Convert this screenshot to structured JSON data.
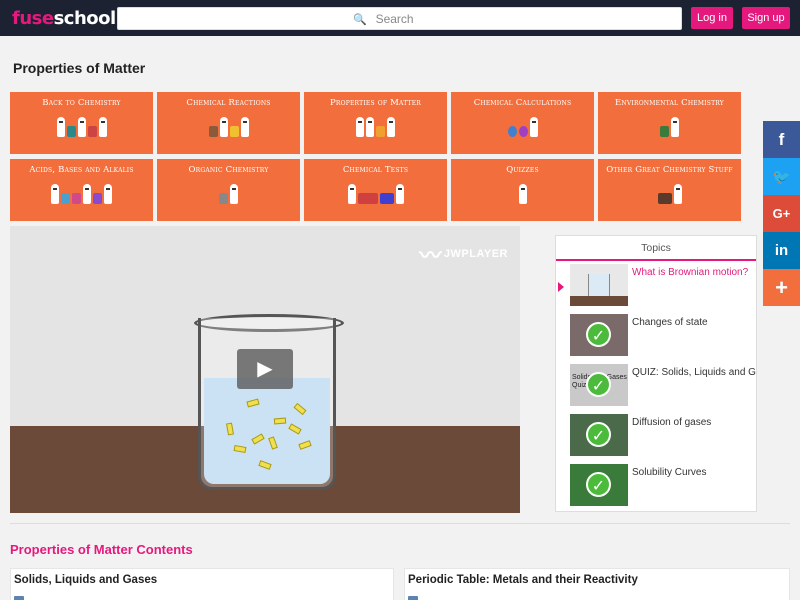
{
  "header": {
    "logo_prefix": "fuse",
    "logo_suffix": "school",
    "search_placeholder": "Search",
    "login_label": "Log in",
    "signup_label": "Sign up"
  },
  "page_title": "Properties of Matter",
  "categories": [
    {
      "label": "Back to Chemistry"
    },
    {
      "label": "Chemical Reactions"
    },
    {
      "label": "Properties of Matter"
    },
    {
      "label": "Chemical Calculations"
    },
    {
      "label": "Environmental Chemistry"
    },
    {
      "label": "Acids, Bases and Alkalis"
    },
    {
      "label": "Organic Chemistry"
    },
    {
      "label": "Chemical Tests"
    },
    {
      "label": "Quizzes"
    },
    {
      "label": "Other Great Chemistry Stuff"
    }
  ],
  "player": {
    "brand": "JWPLAYER"
  },
  "topics": {
    "header": "Topics",
    "items": [
      {
        "label": "What is Brownian motion?",
        "active": true,
        "completed": false,
        "thumb_text": ""
      },
      {
        "label": "Changes of state",
        "active": false,
        "completed": true,
        "thumb_text": ""
      },
      {
        "label": "QUIZ: Solids, Liquids and Gases",
        "active": false,
        "completed": true,
        "thumb_text": "Solids and Gases Quiz"
      },
      {
        "label": "Diffusion of gases",
        "active": false,
        "completed": true,
        "thumb_text": ""
      },
      {
        "label": "Solubility Curves",
        "active": false,
        "completed": true,
        "thumb_text": ""
      }
    ]
  },
  "social": [
    {
      "icon": "facebook-icon",
      "glyph": "f",
      "color": "#3b5998"
    },
    {
      "icon": "twitter-icon",
      "glyph": "🐦",
      "color": "#1da1f2"
    },
    {
      "icon": "google-plus-icon",
      "glyph": "G+",
      "color": "#dd4b39"
    },
    {
      "icon": "linkedin-icon",
      "glyph": "in",
      "color": "#0077b5"
    },
    {
      "icon": "share-more-icon",
      "glyph": "+",
      "color": "#f26f3d"
    }
  ],
  "contents": {
    "title": "Properties of Matter Contents",
    "cards": [
      {
        "title": "Solids, Liquids and Gases"
      },
      {
        "title": "Periodic Table: Metals and their Reactivity"
      }
    ]
  },
  "colors": {
    "accent": "#e5197d",
    "tile": "#f26f3d",
    "header": "#1d2233"
  }
}
